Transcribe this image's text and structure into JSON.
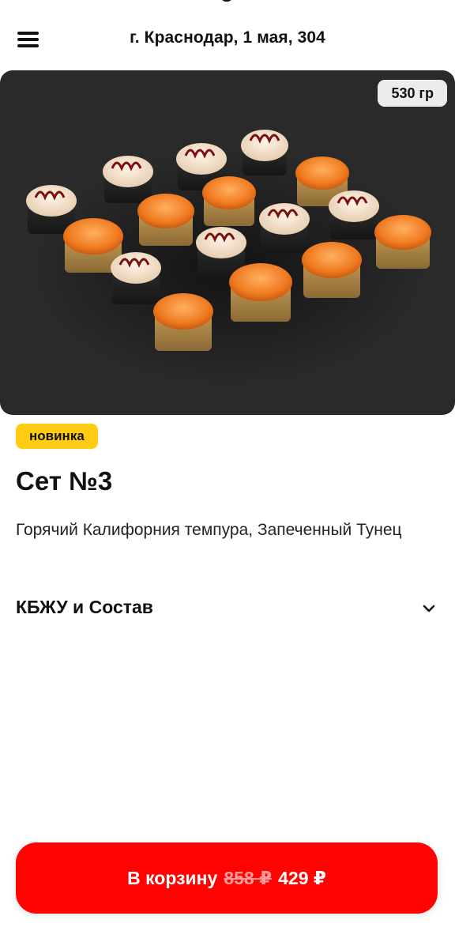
{
  "header": {
    "address": "г. Краснодар, 1 мая,  304"
  },
  "product": {
    "image_alt": "Сет №3",
    "weight": "530 гр",
    "badge": "новинка",
    "title": "Сет №3",
    "description": "Горячий Калифорния темпура, Запеченный Тунец"
  },
  "accordion": {
    "label": "КБЖУ и Состав"
  },
  "cart": {
    "label": "В корзину",
    "old_price": "858 ₽",
    "price": "429 ₽"
  },
  "colors": {
    "accent": "#ff0303",
    "badge_yellow": "#ffcc13",
    "hero_bg": "#2a2a2a"
  }
}
